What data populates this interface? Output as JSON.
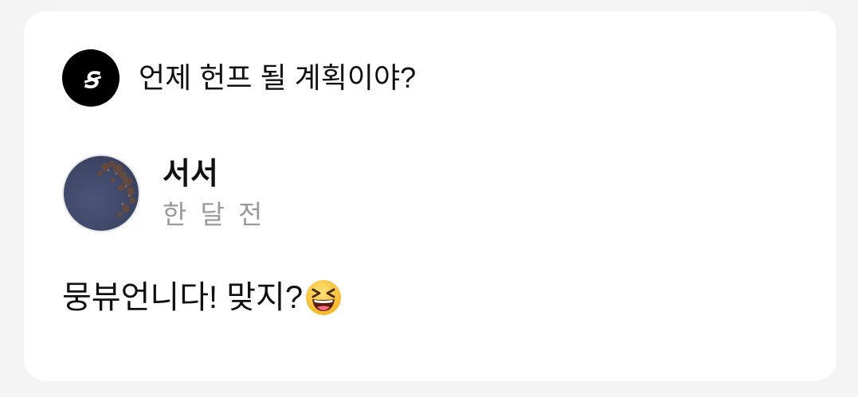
{
  "card": {
    "question": {
      "icon": "brand-logo-icon",
      "icon_glyph": "ꞩ",
      "text": "언제 헌프 될 계획이야?"
    },
    "author": {
      "avatar": "night-sky-tree-photo",
      "name": "서서",
      "time": "한 달 전"
    },
    "answer": {
      "text": "뭉뷰언니다! 맞지?",
      "emoji": "grinning-squinting-face-emoji"
    }
  },
  "colors": {
    "background": "#f4f4f4",
    "card": "#ffffff",
    "brand_icon_bg": "#000000",
    "primary_text": "#111111",
    "secondary_text": "#9a9a9a"
  }
}
